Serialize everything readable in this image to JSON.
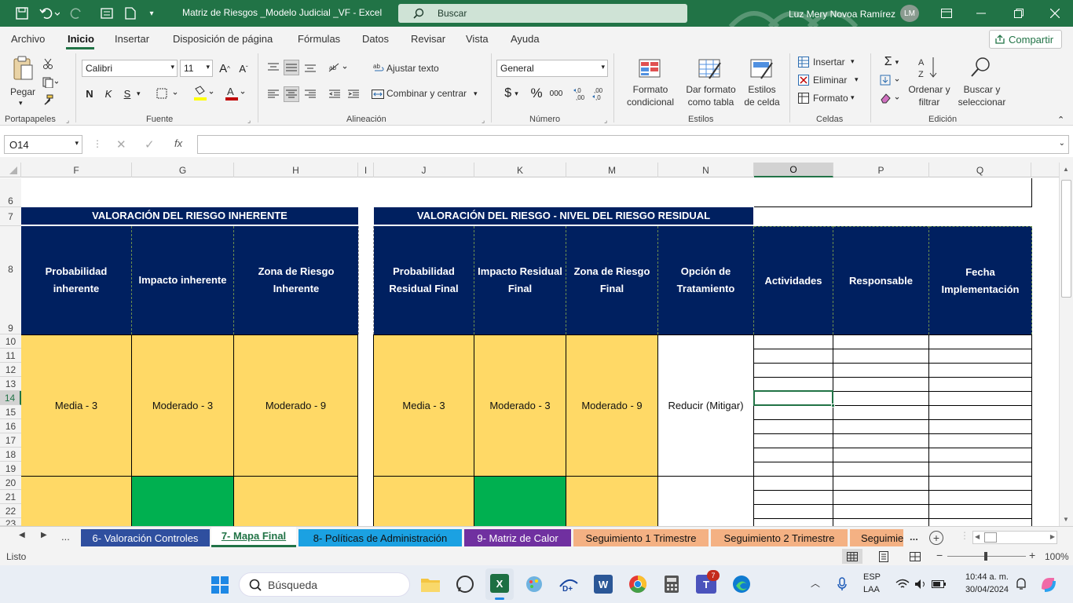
{
  "titlebar": {
    "title": "Matriz de Riesgos _Modelo Judicial _VF  -  Excel",
    "search_placeholder": "Buscar",
    "user_name": "Luz Mery Novoa Ramírez",
    "user_initials": "LM"
  },
  "menu": {
    "items": [
      "Archivo",
      "Inicio",
      "Insertar",
      "Disposición de página",
      "Fórmulas",
      "Datos",
      "Revisar",
      "Vista",
      "Ayuda"
    ],
    "active": "Inicio",
    "share_label": "Compartir"
  },
  "ribbon": {
    "clipboard": {
      "paste_label": "Pegar",
      "group_label": "Portapapeles"
    },
    "font": {
      "name": "Calibri",
      "size": "11",
      "bold": "N",
      "italic": "K",
      "underline": "S",
      "group_label": "Fuente"
    },
    "alignment": {
      "wrap_label": "Ajustar texto",
      "merge_label": "Combinar y centrar",
      "group_label": "Alineación"
    },
    "number": {
      "format": "General",
      "currency": "$",
      "percent": "%",
      "thousands": "000",
      "inc_dec": ",0\n,00",
      "dec_dec": ",00\n,0",
      "group_label": "Número"
    },
    "styles": {
      "cond_format": "Formato condicional",
      "table_format": "Dar formato como tabla",
      "cell_styles": "Estilos de celda",
      "group_label": "Estilos"
    },
    "cells": {
      "insert": "Insertar",
      "delete": "Eliminar",
      "format": "Formato",
      "group_label": "Celdas"
    },
    "editing": {
      "sort": "Ordenar y filtrar",
      "find": "Buscar y seleccionar",
      "group_label": "Edición"
    }
  },
  "formula_bar": {
    "name_box": "O14",
    "fx": "fx",
    "value": ""
  },
  "columns": [
    "F",
    "G",
    "H",
    "I",
    "J",
    "K",
    "M",
    "N",
    "O",
    "P",
    "Q"
  ],
  "rows": [
    "6",
    "7",
    "8",
    "9",
    "10",
    "11",
    "12",
    "13",
    "14",
    "15",
    "16",
    "17",
    "18",
    "19",
    "20",
    "21",
    "22",
    "23"
  ],
  "sheet": {
    "section_inherent": "VALORACIÓN DEL RIESGO INHERENTE",
    "section_residual": "VALORACIÓN  DEL RIESGO - NIVEL DEL RIESGO RESIDUAL",
    "headers": [
      "Probabilidad inherente",
      "Impacto inherente",
      "Zona de Riesgo Inherente",
      "Probabilidad Residual Final",
      "Impacto Residual Final",
      "Zona de Riesgo Final",
      "Opción de Tratamiento",
      "Actividades",
      "Responsable",
      "Fecha Implementación"
    ],
    "row1": [
      "Media - 3",
      "Moderado - 3",
      "Moderado - 9",
      "Media - 3",
      "Moderado - 3",
      "Moderado - 9",
      "Reducir (Mitigar)"
    ],
    "colors": {
      "navy": "#002060",
      "yellow": "#FFD966",
      "green": "#00B050",
      "excel_green": "#217346"
    }
  },
  "sheet_tabs": {
    "ellipsis": "...",
    "tabs": [
      {
        "label": "6- Valoración Controles",
        "color": "#2F4F9F",
        "text": "#ffffff"
      },
      {
        "label": "7- Mapa Final",
        "color": "#ffffff",
        "text": "#217346",
        "active": true
      },
      {
        "label": "8- Políticas de Administración",
        "color": "#1BA1E2",
        "text": "#111111"
      },
      {
        "label": "9- Matriz de Calor",
        "color": "#7030A0",
        "text": "#ffffff"
      },
      {
        "label": "Seguimiento 1 Trimestre",
        "color": "#F4B183",
        "text": "#111111"
      },
      {
        "label": "Seguimiento 2 Trimestre",
        "color": "#F4B183",
        "text": "#111111"
      },
      {
        "label": "Seguimie",
        "color": "#F4B183",
        "text": "#111111"
      }
    ],
    "more": "..."
  },
  "status": {
    "ready": "Listo",
    "zoom": "100%"
  },
  "taskbar": {
    "search": "Búsqueda",
    "lang1": "ESP",
    "lang2": "LAA",
    "time": "10:44 a. m.",
    "date": "30/04/2024",
    "badge": "7"
  }
}
